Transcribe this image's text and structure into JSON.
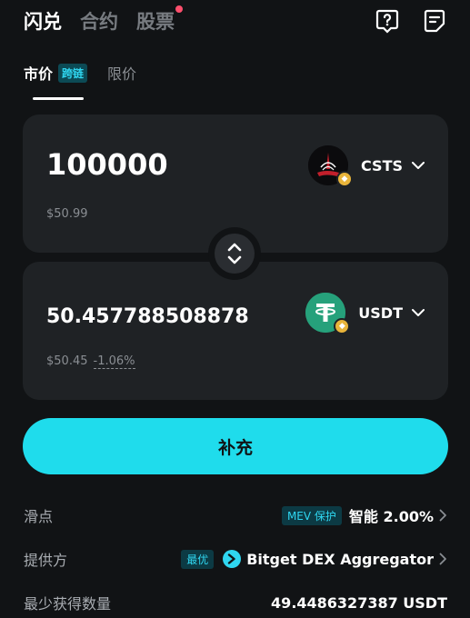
{
  "top_tabs": [
    {
      "label": "闪兑",
      "active": true
    },
    {
      "label": "合约",
      "active": false
    },
    {
      "label": "股票",
      "active": false,
      "dot_color": "#ff4f6d"
    }
  ],
  "top_icons": [
    "help-chat-icon",
    "order-list-icon"
  ],
  "sub_tabs": {
    "market": "市价",
    "cross_chain_badge": "跨链",
    "limit": "限价"
  },
  "from": {
    "amount": "100000",
    "usd_value": "$50.99",
    "token": "CSTS",
    "token_icon": "csts-token-icon",
    "chain_icon": "bnb-chain-icon"
  },
  "to": {
    "amount": "50.457788508878",
    "usd_value": "$50.45",
    "price_impact": "-1.06%",
    "token": "USDT",
    "token_icon": "usdt-token-icon",
    "chain_icon": "bnb-chain-icon"
  },
  "action_button": "补充",
  "info": {
    "slippage_label": "滑点",
    "mev_badge": "MEV 保护",
    "slippage_value": "智能 2.00%",
    "provider_label": "提供方",
    "best_badge": "最优",
    "provider_value": "Bitget DEX Aggregator",
    "min_receive_label": "最少获得数量",
    "min_receive_value": "49.4486327387 USDT"
  },
  "colors": {
    "accent": "#1fdcec",
    "background": "#111315",
    "card": "#1f2225",
    "tether_green": "#26a17b",
    "chain_gold": "#e8b43a"
  }
}
